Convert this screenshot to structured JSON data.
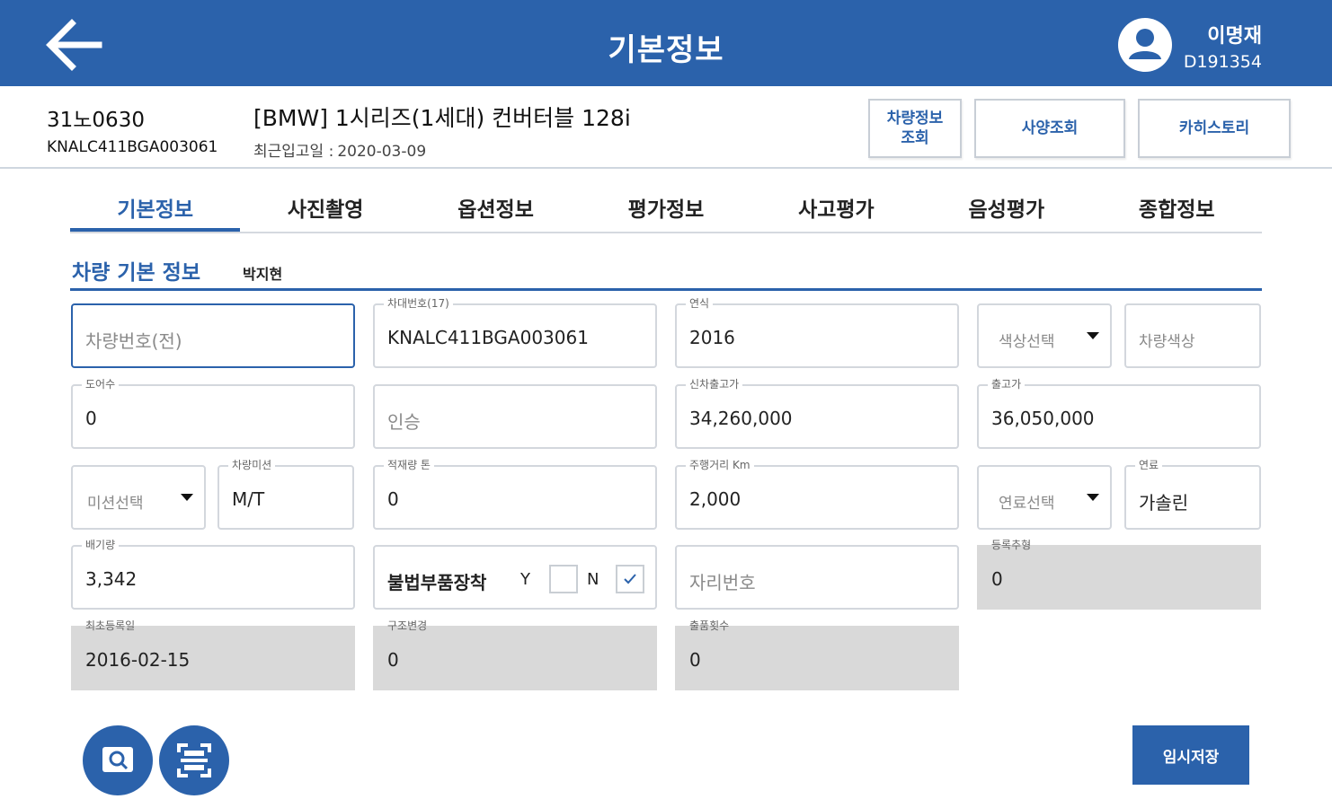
{
  "header": {
    "title": "기본정보",
    "user_name": "이명재",
    "user_id": "D191354",
    "back_icon": "arrow-left-icon",
    "avatar_icon": "user-avatar-icon"
  },
  "vehicle": {
    "plate": "31노0630",
    "vin": "KNALC411BGA003061",
    "model": "[BMW] 1시리즈(1세대) 컨버터블 128i",
    "recent_label": "최근입고일 :",
    "recent_date": "2020-03-09"
  },
  "header_buttons": {
    "carinfo_line1": "차량정보",
    "carinfo_line2": "조회",
    "spec": "사양조회",
    "carhistory": "카히스토리"
  },
  "tabs": [
    "기본정보",
    "사진촬영",
    "옵션정보",
    "평가정보",
    "사고평가",
    "음성평가",
    "종합정보"
  ],
  "section": {
    "title": "차량 기본 정보",
    "user": "박지현"
  },
  "fields": {
    "plate_prev": {
      "placeholder": "차량번호(전)"
    },
    "vin": {
      "label": "차대번호(17)",
      "value": "KNALC411BGA003061"
    },
    "year": {
      "label": "연식",
      "value": "2016"
    },
    "color_select": {
      "placeholder": "색상선택"
    },
    "color": {
      "placeholder": "차량색상"
    },
    "doors": {
      "label": "도어수",
      "value": "0"
    },
    "capacity": {
      "placeholder": "인승"
    },
    "new_price": {
      "label": "신차출고가",
      "value": "34,260,000"
    },
    "release_price": {
      "label": "출고가",
      "value": "36,050,000"
    },
    "mission_select": {
      "placeholder": "미션선택"
    },
    "mission": {
      "label": "차량미션",
      "value": "M/T"
    },
    "load": {
      "label": "적재량 톤",
      "value": "0"
    },
    "mileage": {
      "label": "주행거리 Km",
      "value": "2,000"
    },
    "fuel_select": {
      "placeholder": "연료선택"
    },
    "fuel": {
      "label": "연료",
      "value": "가솔린"
    },
    "displacement": {
      "label": "배기량",
      "value": "3,342"
    },
    "illegal_parts": {
      "label": "불법부품장착",
      "y": "Y",
      "n": "N",
      "checked": "N"
    },
    "seat_no": {
      "placeholder": "자리번호"
    },
    "reg_count": {
      "label": "등록추형",
      "value": "0"
    },
    "first_reg": {
      "label": "최초등록일",
      "value": "2016-02-15"
    },
    "structure_change": {
      "label": "구조변경",
      "value": "0"
    },
    "export_count": {
      "label": "출품횟수",
      "value": "0"
    }
  },
  "bottom": {
    "search_icon": "search-icon",
    "scan_icon": "scan-icon",
    "save_label": "임시저장"
  },
  "colors": {
    "primary": "#2b62ab",
    "readonly_bg": "#d9d9d9"
  }
}
